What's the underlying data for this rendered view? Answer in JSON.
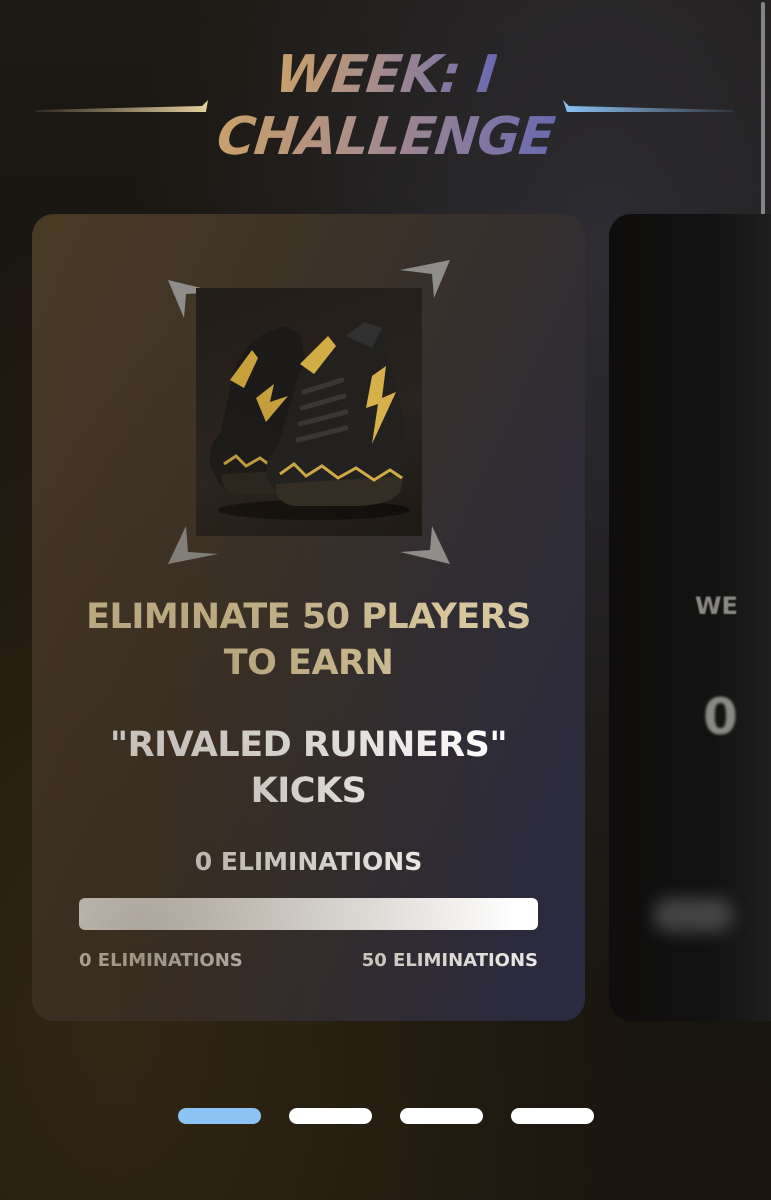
{
  "header": {
    "title_line1": "WEEK: I",
    "title_line2": "CHALLENGE"
  },
  "challenge": {
    "reward_icon": "sneakers-icon",
    "objective_line1": "ELIMINATE 50 PLAYERS",
    "objective_line2": "TO EARN",
    "reward_line1": "\"RIVALED RUNNERS\"",
    "reward_line2": "KICKS",
    "progress_text": "0 ELIMINATIONS",
    "progress_fraction": 0,
    "min_label": "0 ELIMINATIONS",
    "max_label": "50 ELIMINATIONS"
  },
  "next_card": {
    "title_partial": "WE",
    "digit_partial": "0"
  },
  "pager": {
    "count": 4,
    "active_index": 0
  },
  "colors": {
    "objective_text": "#d8c69c",
    "accent_blue": "#8bc3f5",
    "title_gradient_start": "#c9a16a",
    "title_gradient_end": "#6a6ab0"
  }
}
